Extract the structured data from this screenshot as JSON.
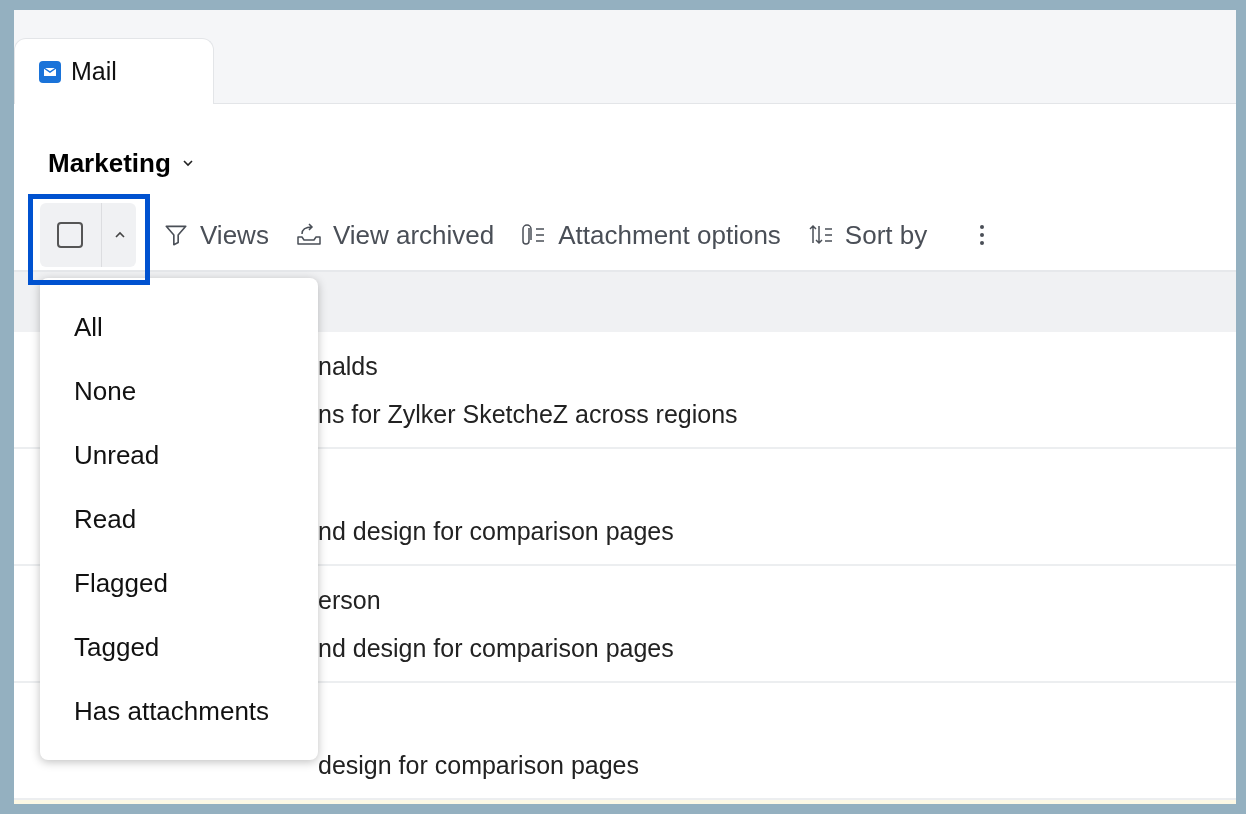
{
  "tabs": [
    {
      "label": "Mail",
      "selected": true
    }
  ],
  "folder": {
    "title": "Marketing"
  },
  "toolbar": {
    "select_checked": false,
    "items": [
      {
        "kind": "views",
        "label": "Views"
      },
      {
        "kind": "archive",
        "label": "View archived"
      },
      {
        "kind": "attachment",
        "label": "Attachment options"
      },
      {
        "kind": "sort",
        "label": "Sort by"
      },
      {
        "kind": "more"
      }
    ]
  },
  "select_menu": {
    "items": [
      "All",
      "None",
      "Unread",
      "Read",
      "Flagged",
      "Tagged",
      "Has attachments"
    ]
  },
  "messages": [
    {
      "sender": "nalds",
      "subject": "ns for Zylker SketcheZ across regions"
    },
    {
      "subject": "nd design for comparison pages"
    },
    {
      "sender": "erson",
      "subject": "nd design for comparison pages"
    },
    {
      "subject": "design for comparison pages"
    }
  ]
}
